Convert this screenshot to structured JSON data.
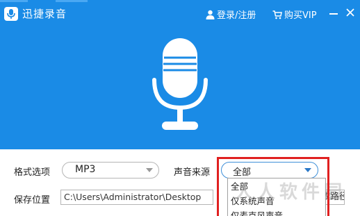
{
  "window": {
    "title": "迅捷录音",
    "login_label": "登录/注册",
    "vip_label": "购买VIP",
    "accent_color": "#1a8be6"
  },
  "icons": {
    "logo": "microphone-logo-icon",
    "user": "user-icon",
    "cart": "cart-icon",
    "minimize": "minimize-icon",
    "close": "close-icon",
    "hero": "microphone-icon"
  },
  "form": {
    "format_label": "格式选项",
    "format_value": "MP3",
    "source_label": "声音来源",
    "source_value": "全部",
    "save_path_label": "保存位置",
    "save_path_value": "C:\\Users\\Administrator\\Desktop",
    "change_path_label": "更改路径"
  },
  "source_dropdown": {
    "options": [
      "全部",
      "仅系统声音",
      "仅麦克风声音"
    ]
  },
  "watermark": "人人软件园"
}
